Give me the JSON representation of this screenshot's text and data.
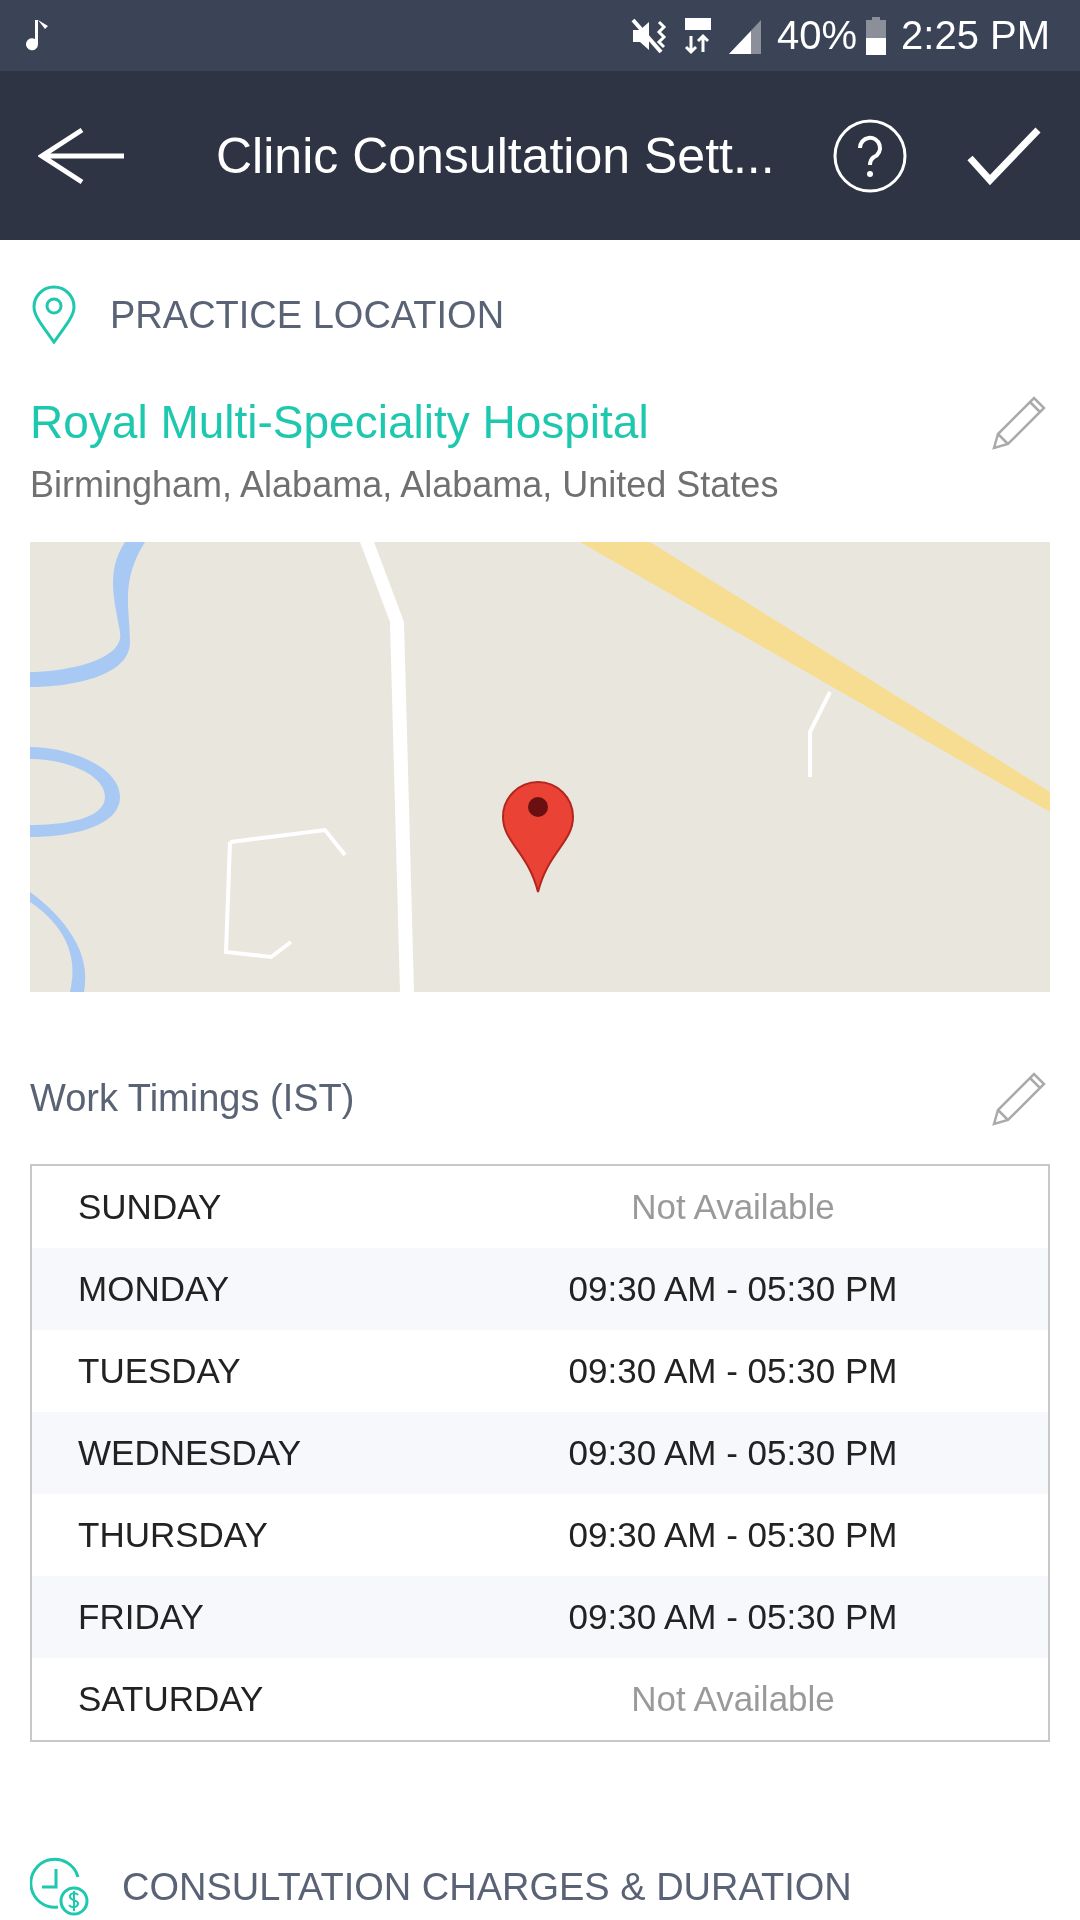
{
  "status_bar": {
    "battery": "40%",
    "time": "2:25 PM"
  },
  "app_bar": {
    "title": "Clinic Consultation Sett..."
  },
  "practice_location": {
    "heading": "PRACTICE LOCATION",
    "name": "Royal Multi-Speciality Hospital",
    "address": "Birmingham, Alabama, Alabama, United States"
  },
  "work_timings": {
    "heading": "Work Timings (IST)",
    "rows": [
      {
        "day": "SUNDAY",
        "hours": "Not Available",
        "available": false
      },
      {
        "day": "MONDAY",
        "hours": "09:30 AM - 05:30 PM",
        "available": true
      },
      {
        "day": "TUESDAY",
        "hours": "09:30 AM - 05:30 PM",
        "available": true
      },
      {
        "day": "WEDNESDAY",
        "hours": "09:30 AM - 05:30 PM",
        "available": true
      },
      {
        "day": "THURSDAY",
        "hours": "09:30 AM - 05:30 PM",
        "available": true
      },
      {
        "day": "FRIDAY",
        "hours": "09:30 AM - 05:30 PM",
        "available": true
      },
      {
        "day": "SATURDAY",
        "hours": "Not Available",
        "available": false
      }
    ]
  },
  "consultation": {
    "heading": "CONSULTATION CHARGES & DURATION"
  }
}
